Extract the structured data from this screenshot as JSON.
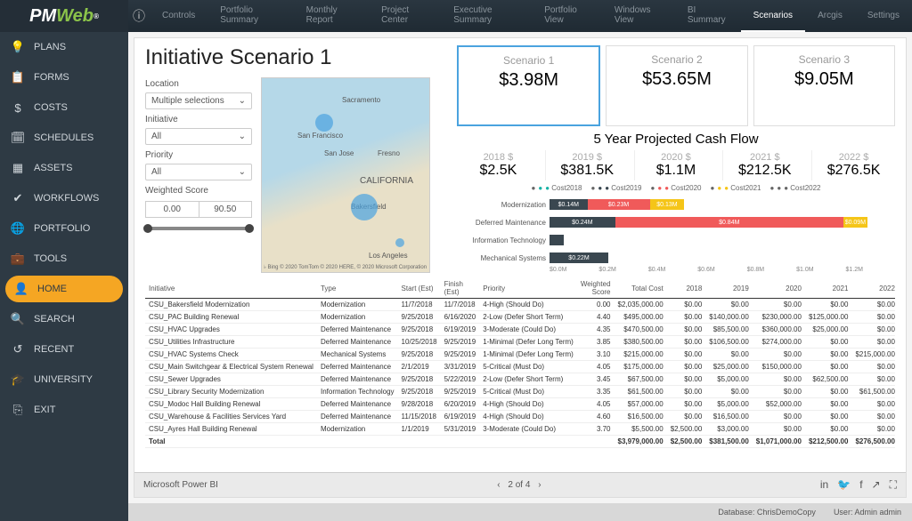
{
  "topbar": {
    "logo_main": "PM",
    "logo_accent": "Web",
    "tabs": [
      "Controls",
      "Portfolio Summary",
      "Monthly Report",
      "Project Center",
      "Executive Summary",
      "Portfolio View",
      "Windows View",
      "BI Summary",
      "Scenarios",
      "Arcgis",
      "Settings"
    ],
    "active_tab": 8
  },
  "sidebar": {
    "items": [
      {
        "icon": "💡",
        "label": "PLANS"
      },
      {
        "icon": "📋",
        "label": "FORMS"
      },
      {
        "icon": "$",
        "label": "COSTS"
      },
      {
        "icon": "🗓",
        "label": "SCHEDULES"
      },
      {
        "icon": "▦",
        "label": "ASSETS"
      },
      {
        "icon": "✔",
        "label": "WORKFLOWS"
      },
      {
        "icon": "🌐",
        "label": "PORTFOLIO"
      },
      {
        "icon": "💼",
        "label": "TOOLS"
      },
      {
        "icon": "👤",
        "label": "HOME",
        "active": true
      },
      {
        "icon": "🔍",
        "label": "SEARCH"
      },
      {
        "icon": "↺",
        "label": "RECENT"
      },
      {
        "icon": "🎓",
        "label": "UNIVERSITY"
      },
      {
        "icon": "⎘",
        "label": "EXIT"
      }
    ]
  },
  "page": {
    "title": "Initiative Scenario 1",
    "filters": {
      "location_label": "Location",
      "location_value": "Multiple selections",
      "initiative_label": "Initiative",
      "initiative_value": "All",
      "priority_label": "Priority",
      "priority_value": "All",
      "weighted_label": "Weighted Score",
      "weighted_min": "0.00",
      "weighted_max": "90.50"
    },
    "map_attrib": "♭ Bing   © 2020 TomTom © 2020 HERE, © 2020 Microsoft Corporation",
    "scenarios": [
      {
        "name": "Scenario 1",
        "value": "$3.98M",
        "active": true
      },
      {
        "name": "Scenario 2",
        "value": "$53.65M"
      },
      {
        "name": "Scenario 3",
        "value": "$9.05M"
      }
    ],
    "cashflow_title": "5 Year Projected Cash Flow",
    "years": [
      {
        "label": "2018 $",
        "value": "$2.5K"
      },
      {
        "label": "2019 $",
        "value": "$381.5K"
      },
      {
        "label": "2020 $",
        "value": "$1.1M"
      },
      {
        "label": "2021 $",
        "value": "$212.5K"
      },
      {
        "label": "2022 $",
        "value": "$276.5K"
      }
    ],
    "legend": [
      "Cost2018",
      "Cost2019",
      "Cost2020",
      "Cost2021",
      "Cost2022"
    ],
    "bar_categories": [
      {
        "label": "Modernization",
        "segs": [
          {
            "w": 11,
            "c": "#3a4750",
            "t": "$0.14M"
          },
          {
            "w": 18,
            "c": "#f05a5a",
            "t": "$0.23M"
          },
          {
            "w": 10,
            "c": "#f5c518",
            "t": "$0.13M"
          }
        ]
      },
      {
        "label": "Deferred Maintenance",
        "segs": [
          {
            "w": 19,
            "c": "#3a4750",
            "t": "$0.24M"
          },
          {
            "w": 66,
            "c": "#f05a5a",
            "t": "$0.84M"
          },
          {
            "w": 7,
            "c": "#f5c518",
            "t": "$0.09M"
          }
        ]
      },
      {
        "label": "Information Technology",
        "segs": [
          {
            "w": 4,
            "c": "#3a4750",
            "t": ""
          }
        ]
      },
      {
        "label": "Mechanical Systems",
        "segs": [
          {
            "w": 17,
            "c": "#3a4750",
            "t": "$0.22M"
          }
        ]
      }
    ],
    "bar_axis": [
      "$0.0M",
      "$0.2M",
      "$0.4M",
      "$0.6M",
      "$0.8M",
      "$1.0M",
      "$1.2M"
    ],
    "table": {
      "headers": [
        "Initiative",
        "Type",
        "Start (Est)",
        "Finish (Est)",
        "Priority",
        "Weighted Score",
        "Total Cost",
        "2018",
        "2019",
        "2020",
        "2021",
        "2022"
      ],
      "rows": [
        [
          "CSU_Bakersfield Modernization",
          "Modernization",
          "11/7/2018",
          "11/7/2018",
          "4-High (Should Do)",
          "0.00",
          "$2,035,000.00",
          "$0.00",
          "$0.00",
          "$0.00",
          "$0.00",
          "$0.00"
        ],
        [
          "CSU_PAC Building Renewal",
          "Modernization",
          "9/25/2018",
          "6/16/2020",
          "2-Low (Defer Short Term)",
          "4.40",
          "$495,000.00",
          "$0.00",
          "$140,000.00",
          "$230,000.00",
          "$125,000.00",
          "$0.00"
        ],
        [
          "CSU_HVAC Upgrades",
          "Deferred Maintenance",
          "9/25/2018",
          "6/19/2019",
          "3-Moderate (Could Do)",
          "4.35",
          "$470,500.00",
          "$0.00",
          "$85,500.00",
          "$360,000.00",
          "$25,000.00",
          "$0.00"
        ],
        [
          "CSU_Utilities Infrastructure",
          "Deferred Maintenance",
          "10/25/2018",
          "9/25/2019",
          "1-Minimal (Defer Long Term)",
          "3.85",
          "$380,500.00",
          "$0.00",
          "$106,500.00",
          "$274,000.00",
          "$0.00",
          "$0.00"
        ],
        [
          "CSU_HVAC Systems Check",
          "Mechanical Systems",
          "9/25/2018",
          "9/25/2019",
          "1-Minimal (Defer Long Term)",
          "3.10",
          "$215,000.00",
          "$0.00",
          "$0.00",
          "$0.00",
          "$0.00",
          "$215,000.00"
        ],
        [
          "CSU_Main Switchgear & Electrical System Renewal",
          "Deferred Maintenance",
          "2/1/2019",
          "3/31/2019",
          "5-Critical (Must Do)",
          "4.05",
          "$175,000.00",
          "$0.00",
          "$25,000.00",
          "$150,000.00",
          "$0.00",
          "$0.00"
        ],
        [
          "CSU_Sewer Upgrades",
          "Deferred Maintenance",
          "9/25/2018",
          "5/22/2019",
          "2-Low (Defer Short Term)",
          "3.45",
          "$67,500.00",
          "$0.00",
          "$5,000.00",
          "$0.00",
          "$62,500.00",
          "$0.00"
        ],
        [
          "CSU_Library Security Modernization",
          "Information Technology",
          "9/25/2018",
          "9/25/2019",
          "5-Critical (Must Do)",
          "3.35",
          "$61,500.00",
          "$0.00",
          "$0.00",
          "$0.00",
          "$0.00",
          "$61,500.00"
        ],
        [
          "CSU_Modoc Hall Building Renewal",
          "Deferred Maintenance",
          "9/28/2018",
          "6/20/2019",
          "4-High (Should Do)",
          "4.05",
          "$57,000.00",
          "$0.00",
          "$5,000.00",
          "$52,000.00",
          "$0.00",
          "$0.00"
        ],
        [
          "CSU_Warehouse & Facilities Services Yard",
          "Deferred Maintenance",
          "11/15/2018",
          "6/19/2019",
          "4-High (Should Do)",
          "4.60",
          "$16,500.00",
          "$0.00",
          "$16,500.00",
          "$0.00",
          "$0.00",
          "$0.00"
        ],
        [
          "CSU_Ayres Hall Building Renewal",
          "Modernization",
          "1/1/2019",
          "5/31/2019",
          "3-Moderate (Could Do)",
          "3.70",
          "$5,500.00",
          "$2,500.00",
          "$3,000.00",
          "$0.00",
          "$0.00",
          "$0.00"
        ]
      ],
      "total": [
        "Total",
        "",
        "",
        "",
        "",
        "",
        "$3,979,000.00",
        "$2,500.00",
        "$381,500.00",
        "$1,071,000.00",
        "$212,500.00",
        "$276,500.00"
      ]
    }
  },
  "pager": {
    "label": "Microsoft Power BI",
    "pos": "2 of 4"
  },
  "status": {
    "db_label": "Database:",
    "db": "ChrisDemoCopy",
    "user_label": "User:",
    "user": "Admin admin"
  },
  "chart_data": {
    "scenario_totals": {
      "type": "kpi",
      "series": [
        {
          "name": "Scenario 1",
          "value": 3.98,
          "unit": "M"
        },
        {
          "name": "Scenario 2",
          "value": 53.65,
          "unit": "M"
        },
        {
          "name": "Scenario 3",
          "value": 9.05,
          "unit": "M"
        }
      ]
    },
    "cashflow_years": {
      "type": "kpi",
      "categories": [
        "2018",
        "2019",
        "2020",
        "2021",
        "2022"
      ],
      "values": [
        2500,
        381500,
        1100000,
        212500,
        276500
      ],
      "unit": "$"
    },
    "stacked_bar": {
      "type": "bar",
      "orientation": "horizontal",
      "stacked": true,
      "categories": [
        "Modernization",
        "Deferred Maintenance",
        "Information Technology",
        "Mechanical Systems"
      ],
      "series": [
        {
          "name": "Cost2019",
          "color": "#3a4750",
          "values": [
            0.14,
            0.24,
            0.05,
            0.22
          ]
        },
        {
          "name": "Cost2020",
          "color": "#f05a5a",
          "values": [
            0.23,
            0.84,
            0,
            0
          ]
        },
        {
          "name": "Cost2021",
          "color": "#f5c518",
          "values": [
            0.13,
            0.09,
            0,
            0
          ]
        }
      ],
      "xlabel": "$M",
      "xlim": [
        0,
        1.2
      ]
    }
  }
}
